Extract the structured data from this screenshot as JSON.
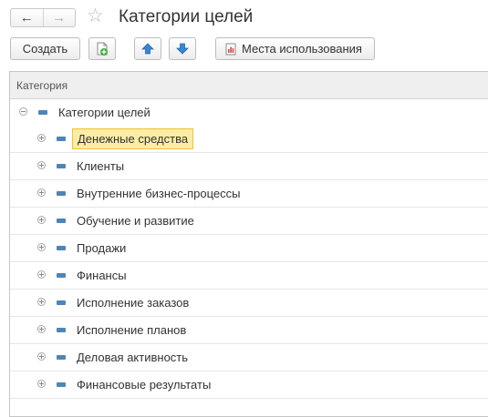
{
  "header": {
    "back_icon": "arrow-left-icon",
    "back_glyph": "←",
    "forward_icon": "arrow-right-icon",
    "forward_glyph": "→",
    "favorite_icon": "star-icon",
    "favorite_glyph": "☆",
    "title": "Категории целей"
  },
  "toolbar": {
    "create_label": "Создать",
    "copy_icon": "copy-add-icon",
    "up_icon": "move-up-icon",
    "down_icon": "move-down-icon",
    "usage_icon": "report-icon",
    "usage_label": "Места использования"
  },
  "grid": {
    "column_header": "Категория",
    "root": {
      "label": "Категории целей",
      "expanded": true
    },
    "items": [
      {
        "label": "Денежные средства",
        "selected": true
      },
      {
        "label": "Клиенты"
      },
      {
        "label": "Внутренние бизнес-процессы"
      },
      {
        "label": "Обучение и развитие"
      },
      {
        "label": "Продажи"
      },
      {
        "label": "Финансы"
      },
      {
        "label": "Исполнение заказов"
      },
      {
        "label": "Исполнение планов"
      },
      {
        "label": "Деловая активность"
      },
      {
        "label": "Финансовые результаты"
      }
    ]
  },
  "colors": {
    "selection_fill": "#fbeda5",
    "selection_border": "#f0c23a",
    "category_icon": "#4d85b7",
    "arrow_button": "#3a86d0",
    "copy_plus": "#3bab3b"
  }
}
